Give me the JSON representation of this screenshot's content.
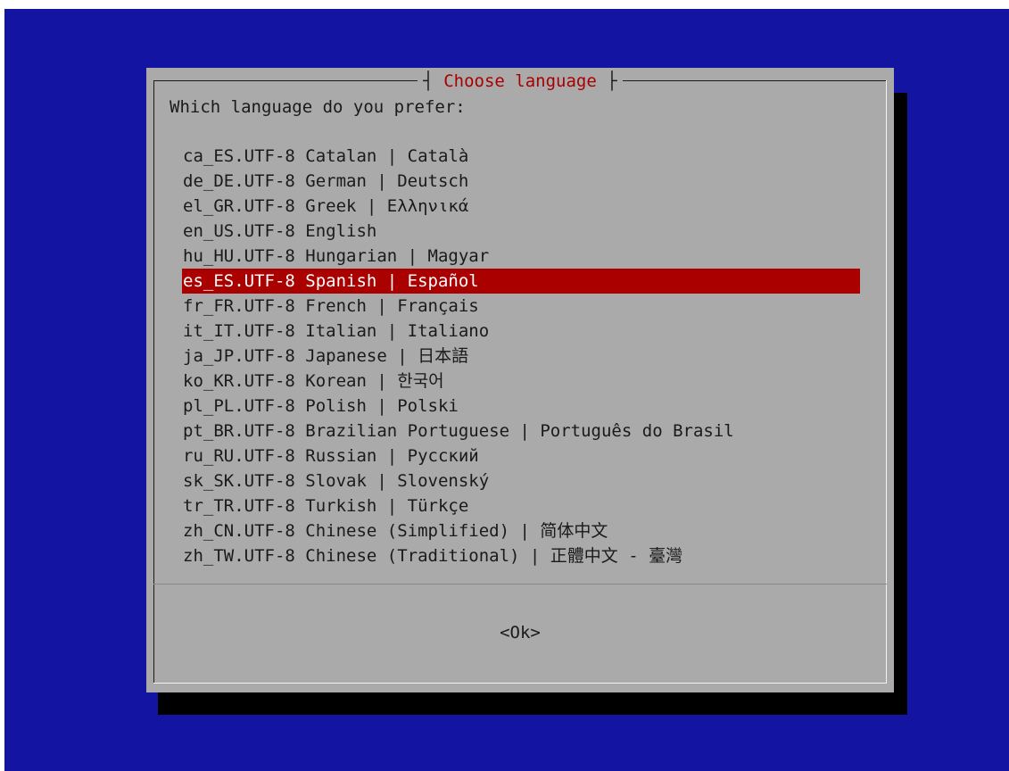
{
  "dialog": {
    "title": "Choose language",
    "title_left_bracket": "┤",
    "title_right_bracket": "├",
    "prompt": "Which language do you prefer:",
    "ok_label": "<Ok>"
  },
  "languages": [
    {
      "label": "ca_ES.UTF-8 Catalan | Català",
      "selected": false
    },
    {
      "label": "de_DE.UTF-8 German | Deutsch",
      "selected": false
    },
    {
      "label": "el_GR.UTF-8 Greek | Ελληνικά",
      "selected": false
    },
    {
      "label": "en_US.UTF-8 English",
      "selected": false
    },
    {
      "label": "hu_HU.UTF-8 Hungarian | Magyar",
      "selected": false
    },
    {
      "label": "es_ES.UTF-8 Spanish | Español",
      "selected": true
    },
    {
      "label": "fr_FR.UTF-8 French | Français",
      "selected": false
    },
    {
      "label": "it_IT.UTF-8 Italian | Italiano",
      "selected": false
    },
    {
      "label": "ja_JP.UTF-8 Japanese | 日本語",
      "selected": false
    },
    {
      "label": "ko_KR.UTF-8 Korean | 한국어",
      "selected": false
    },
    {
      "label": "pl_PL.UTF-8 Polish | Polski",
      "selected": false
    },
    {
      "label": "pt_BR.UTF-8 Brazilian Portuguese | Português do Brasil",
      "selected": false
    },
    {
      "label": "ru_RU.UTF-8 Russian | Русский",
      "selected": false
    },
    {
      "label": "sk_SK.UTF-8 Slovak | Slovenský",
      "selected": false
    },
    {
      "label": "tr_TR.UTF-8 Turkish | Türkçe",
      "selected": false
    },
    {
      "label": "zh_CN.UTF-8 Chinese (Simplified) | 简体中文",
      "selected": false
    },
    {
      "label": "zh_TW.UTF-8 Chinese (Traditional) | 正體中文 - 臺灣",
      "selected": false
    }
  ],
  "colors": {
    "background": "#1414a3",
    "dialog": "#aaaaaa",
    "title": "#a80000",
    "selection": "#aa0000"
  }
}
